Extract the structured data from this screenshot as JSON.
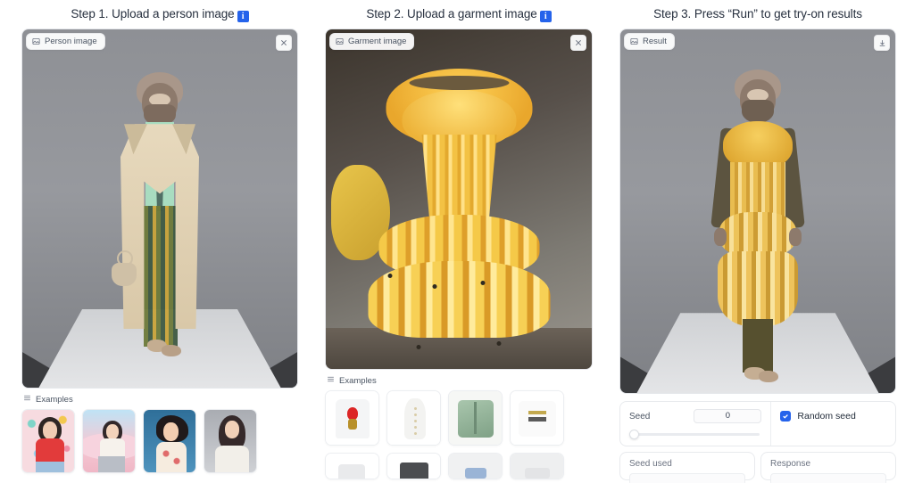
{
  "app": {
    "background": "#ffffff",
    "accent": "#2563eb"
  },
  "steps": [
    {
      "title": "Step 1. Upload a person image",
      "has_info_icon": true,
      "info_icon": "info-icon",
      "panel": {
        "badge_label": "Person image",
        "badge_icon": "image-icon",
        "corner_action": "close-icon"
      },
      "examples": {
        "label": "Examples",
        "icon": "list-icon",
        "items": [
          {
            "alt": "woman in red top on pink confetti background"
          },
          {
            "alt": "woman in white top on pink cloud background"
          },
          {
            "alt": "smiling woman with flowing hair on blue background"
          },
          {
            "alt": "woman in white blouse on grey background"
          }
        ]
      }
    },
    {
      "title": "Step 2. Upload a garment image",
      "has_info_icon": true,
      "info_icon": "info-icon",
      "panel": {
        "badge_label": "Garment image",
        "badge_icon": "image-icon",
        "corner_action": "close-icon"
      },
      "examples": {
        "label": "Examples",
        "icon": "list-icon",
        "items": [
          {
            "alt": "white t-shirt with red cartoon print"
          },
          {
            "alt": "white ribbed button tank top"
          },
          {
            "alt": "green denim jacket"
          },
          {
            "alt": "white t-shirt with logo print"
          },
          {
            "alt": "patterned top"
          },
          {
            "alt": "dark grey sleeveless top"
          },
          {
            "alt": "white shirt with blue graphic"
          },
          {
            "alt": "plain light grey top"
          }
        ]
      }
    },
    {
      "title": "Step 3. Press “Run” to get try-on results",
      "has_info_icon": false,
      "info_icon": "",
      "panel": {
        "badge_label": "Result",
        "badge_icon": "image-icon",
        "corner_action": "download-icon"
      },
      "controls": {
        "seed_label": "Seed",
        "seed_value": "0",
        "seed_slider_position_percent": 0,
        "random_seed_label": "Random seed",
        "random_seed_checked": true,
        "checkbox_icon": "check-icon",
        "seed_used_label": "Seed used",
        "seed_used_value": "",
        "response_label": "Response",
        "response_value": ""
      }
    }
  ]
}
